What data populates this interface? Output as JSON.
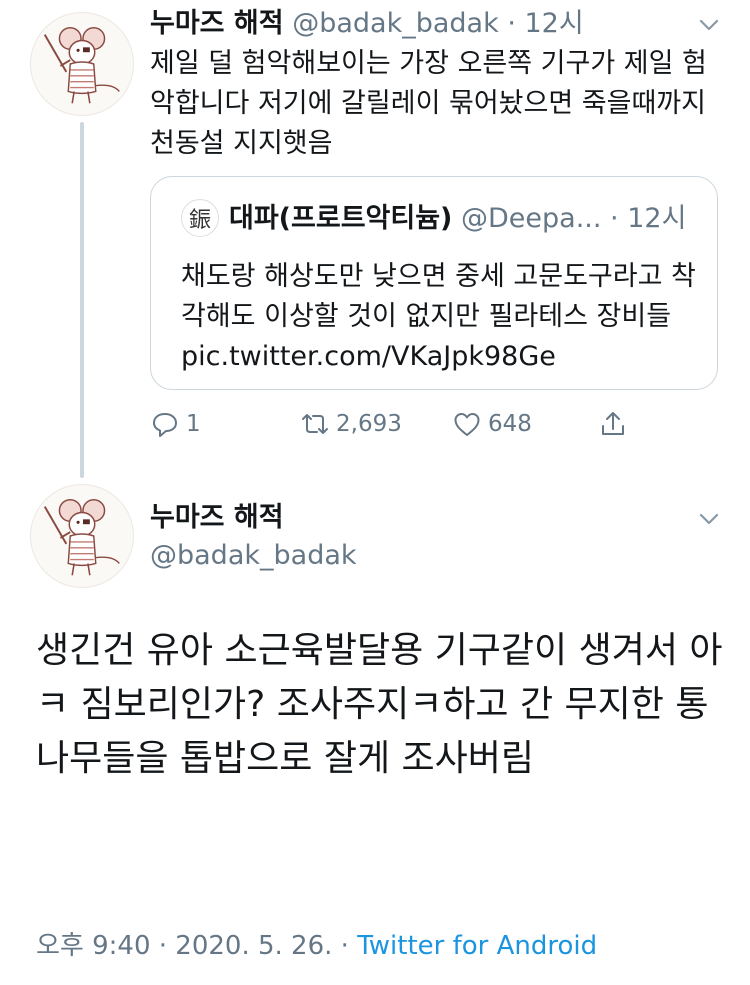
{
  "tweet1": {
    "display_name": "누마즈 해적",
    "handle": "@badak_badak",
    "separator": "·",
    "time": "12시",
    "text": "제일 덜 험악해보이는 가장 오른쪽 기구가 제일 험악합니다 저기에 갈릴레이 묶어놨으면 죽을때까지 천동설 지지햇음",
    "quote": {
      "avatar_glyph": "鋠",
      "display_name": "대파(프로트악티늄)",
      "handle": "@Deepa...",
      "separator": "·",
      "time": "12시",
      "text": "채도랑 해상도만 낮으면 중세 고문도구라고 착각해도 이상할 것이 없지만 필라테스 장비들 pic.twitter.com/VKaJpk98Ge"
    },
    "actions": {
      "reply_count": "1",
      "retweet_count": "2,693",
      "like_count": "648"
    }
  },
  "tweet2": {
    "display_name": "누마즈 해적",
    "handle": "@badak_badak",
    "text": "생긴건 유아 소근육발달용 기구같이 생겨서 아ㅋ 짐보리인가? 조사주지ㅋ하고 간 무지한 통나무들을 톱밥으로 잘게 조사버림",
    "footer": {
      "timestamp": "오후 9:40 · 2020. 5. 26. · ",
      "source": "Twitter for Android"
    }
  },
  "colors": {
    "text_primary": "#14171a",
    "text_secondary": "#657786",
    "link": "#1b95e0",
    "border": "#ccd6dd"
  }
}
